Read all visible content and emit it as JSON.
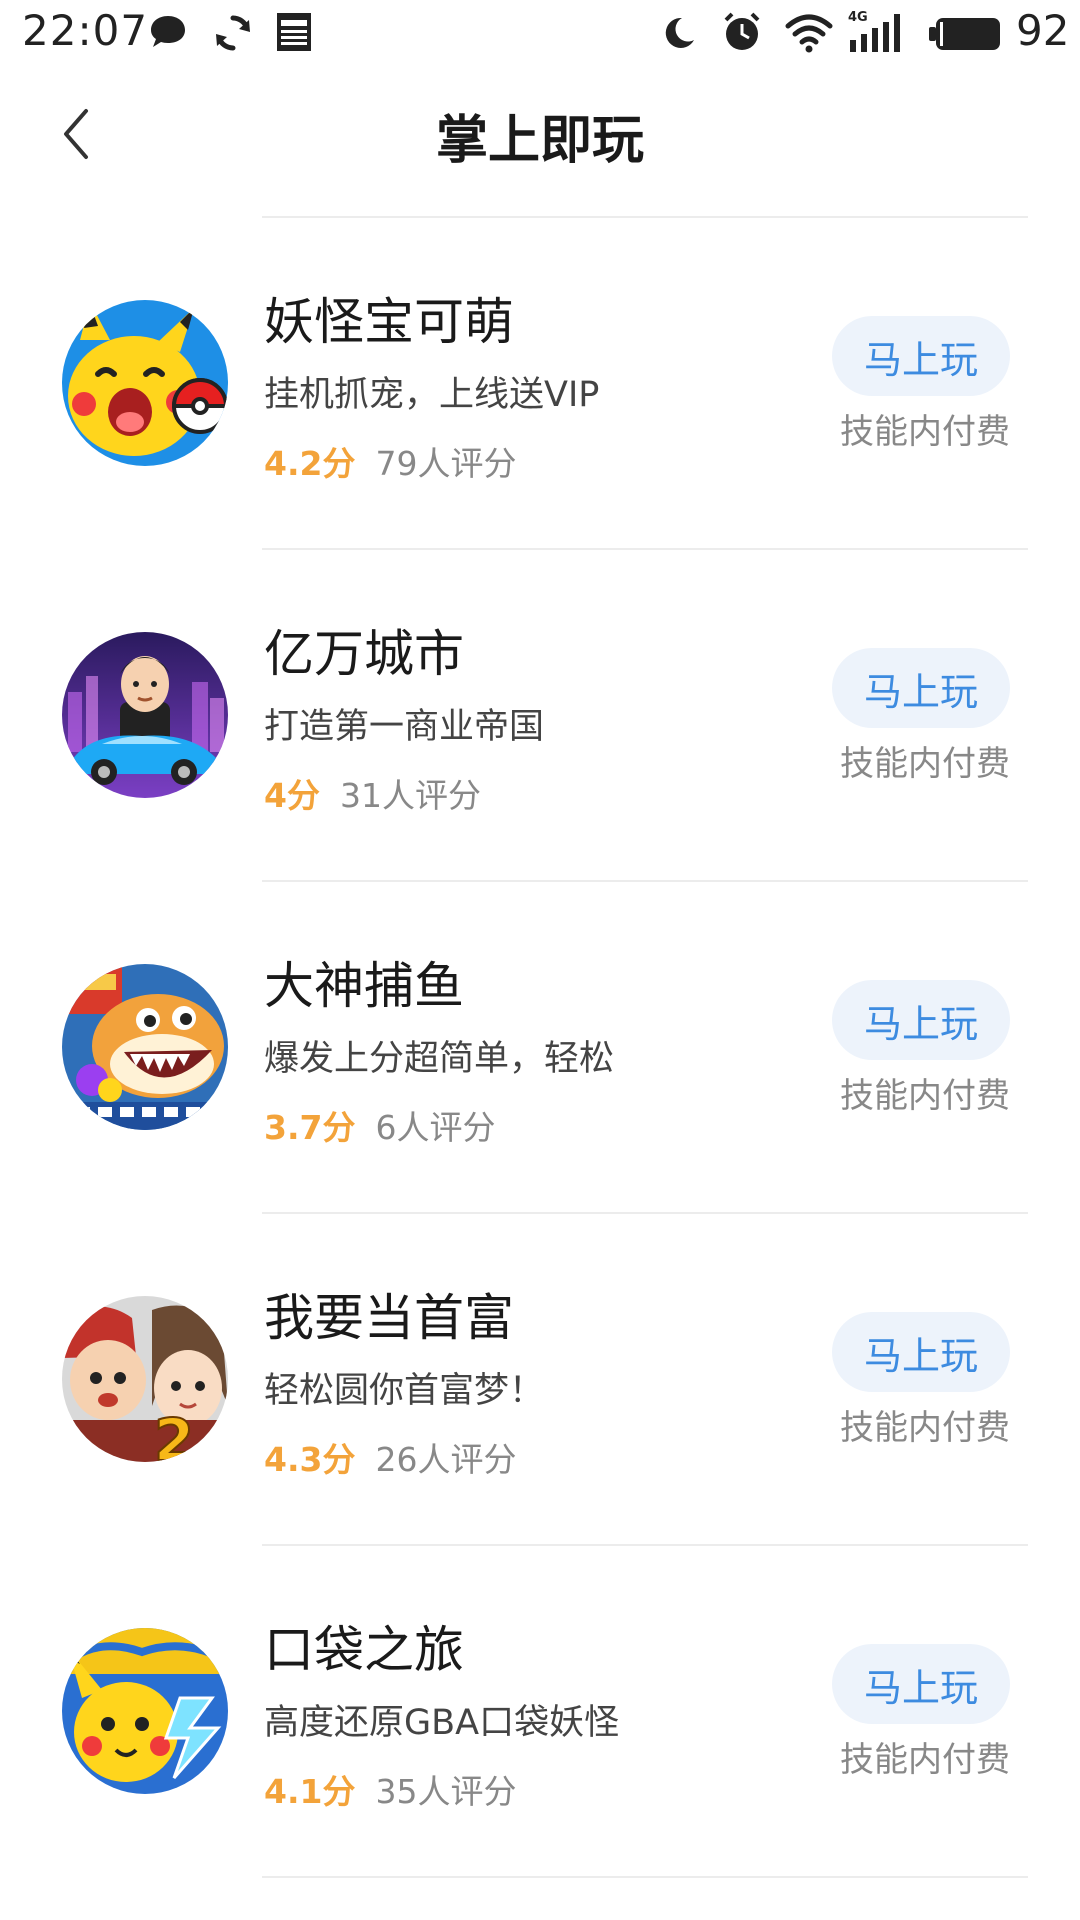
{
  "status_bar": {
    "time": "22:07",
    "battery": "92",
    "left_icons": [
      "chat-bubble-icon",
      "sync-icon",
      "news-icon"
    ],
    "right_icons": [
      "night-mode-icon",
      "alarm-icon",
      "wifi-icon",
      "signal-4g-icon",
      "battery-icon"
    ],
    "network_label": "4G"
  },
  "nav": {
    "title": "掌上即玩",
    "back_icon": "chevron-left-icon"
  },
  "games": [
    {
      "name": "妖怪宝可萌",
      "desc": "挂机抓宠，上线送VIP",
      "score": "4.2分",
      "count": "79人评分",
      "play_label": "马上玩",
      "pay_note": "技能内付费",
      "avatar": "pikachu-pokeball-avatar"
    },
    {
      "name": "亿万城市",
      "desc": "打造第一商业帝国",
      "score": "4分",
      "count": "31人评分",
      "play_label": "马上玩",
      "pay_note": "技能内付费",
      "avatar": "businessman-car-avatar"
    },
    {
      "name": "大神捕鱼",
      "desc": "爆发上分超简单，轻松",
      "score": "3.7分",
      "count": "6人评分",
      "play_label": "马上玩",
      "pay_note": "技能内付费",
      "avatar": "shark-fish-avatar"
    },
    {
      "name": "我要当首富",
      "desc": "轻松圆你首富梦！",
      "score": "4.3分",
      "count": "26人评分",
      "play_label": "马上玩",
      "pay_note": "技能内付费",
      "avatar": "cartoon-couple-avatar"
    },
    {
      "name": "口袋之旅",
      "desc": "高度还原GBA口袋妖怪",
      "score": "4.1分",
      "count": "35人评分",
      "play_label": "马上玩",
      "pay_note": "技能内付费",
      "avatar": "pikachu-lightning-avatar"
    }
  ],
  "colors": {
    "score": "#f3a33a",
    "play_button_text": "#3d8be0",
    "play_button_bg": "#edf3fb",
    "muted_text": "#888888",
    "divider": "#ececec"
  }
}
